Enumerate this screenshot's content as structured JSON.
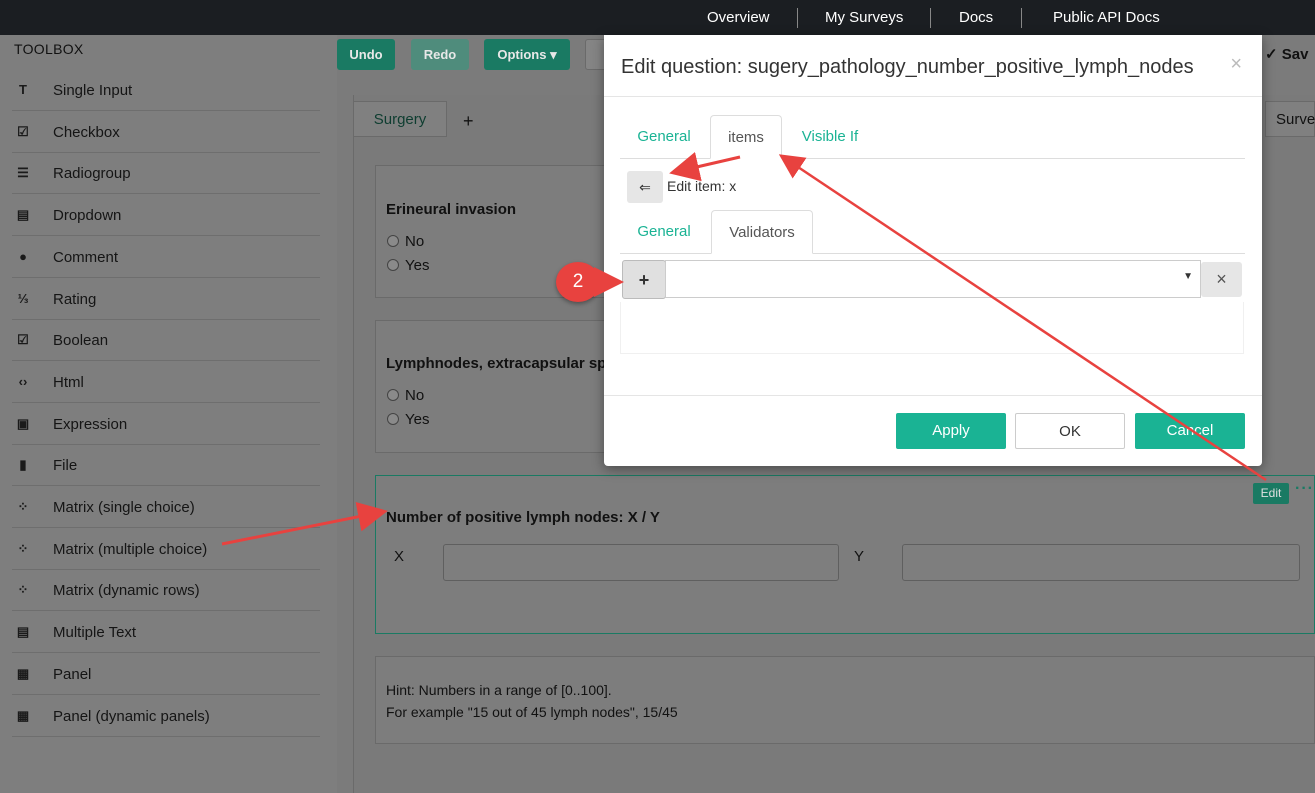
{
  "topnav": {
    "items": [
      "Overview",
      "My Surveys",
      "Docs",
      "Public API Docs"
    ]
  },
  "toolbox": {
    "title": "TOOLBOX",
    "items": [
      {
        "label": "Single Input",
        "icon": "T"
      },
      {
        "label": "Checkbox",
        "icon": "☑"
      },
      {
        "label": "Radiogroup",
        "icon": "☰"
      },
      {
        "label": "Dropdown",
        "icon": "▤"
      },
      {
        "label": "Comment",
        "icon": "●"
      },
      {
        "label": "Rating",
        "icon": "⅓"
      },
      {
        "label": "Boolean",
        "icon": "☑"
      },
      {
        "label": "Html",
        "icon": "‹›"
      },
      {
        "label": "Expression",
        "icon": "▣"
      },
      {
        "label": "File",
        "icon": "▮"
      },
      {
        "label": "Matrix (single choice)",
        "icon": "⁘"
      },
      {
        "label": "Matrix (multiple choice)",
        "icon": "⁘"
      },
      {
        "label": "Matrix (dynamic rows)",
        "icon": "⁘"
      },
      {
        "label": "Multiple Text",
        "icon": "▤"
      },
      {
        "label": "Panel",
        "icon": "▦"
      },
      {
        "label": "Panel (dynamic panels)",
        "icon": "▦"
      }
    ]
  },
  "editor_toolbar": {
    "undo": "Undo",
    "redo": "Redo",
    "options": "Options ▾",
    "save": "Sav",
    "survey": "Survey"
  },
  "page_tab": "Surgery",
  "add_page": "+",
  "questions": {
    "q1": {
      "title": "Erineural invasion",
      "opt1": "No",
      "opt2": "Yes"
    },
    "q2": {
      "title": "Lymphnodes, extracapsular spre",
      "opt1": "No",
      "opt2": "Yes"
    },
    "q3": {
      "title": "Number of positive lymph nodes: X / Y",
      "x_label": "X",
      "y_label": "Y"
    },
    "hint": {
      "line1": "Hint: Numbers in a range of [0..100].",
      "line2": "For example \"15 out of 45 lymph nodes\", 15/45"
    }
  },
  "edit_button": "Edit",
  "dots": "···",
  "modal": {
    "title": "Edit question: sugery_pathology_number_positive_lymph_nodes",
    "close": "×",
    "tabs": [
      "General",
      "items",
      "Visible If"
    ],
    "back_icon": "⇐",
    "edit_item": "Edit item: x",
    "subtabs": [
      "General",
      "Validators"
    ],
    "add_icon": "+",
    "remove_icon": "×",
    "select_value": "",
    "buttons": {
      "apply": "Apply",
      "ok": "OK",
      "cancel": "Cancel"
    }
  },
  "annotation_badge": "2",
  "colors": {
    "accent": "#1ab394",
    "dark_accent": "#1a7a63",
    "arrow": "#e8423f",
    "nav": "#1b1e22"
  }
}
